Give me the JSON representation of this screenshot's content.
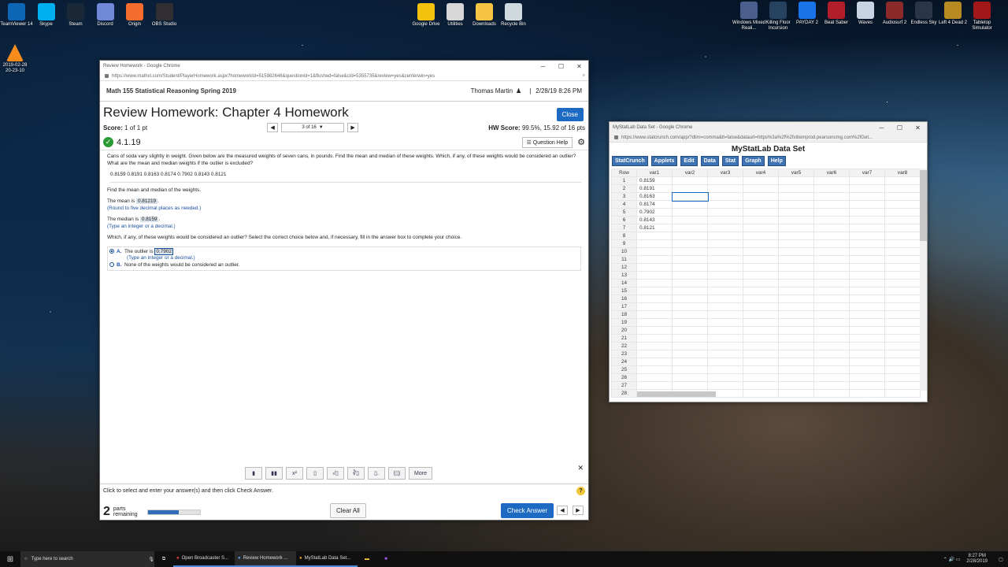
{
  "desktop": {
    "left_icons": [
      {
        "label": "TeamViewer 14",
        "color": "#0e66b7"
      },
      {
        "label": "Skype",
        "color": "#00aff0"
      },
      {
        "label": "Steam",
        "color": "#1b2838"
      },
      {
        "label": "Discord",
        "color": "#7289da"
      },
      {
        "label": "Origin",
        "color": "#f56c2d"
      },
      {
        "label": "OBS Studio",
        "color": "#302e31"
      }
    ],
    "vlc_label": "2019-02-28 20-23-10",
    "center_icons": [
      {
        "label": "Google Drive",
        "color": "#f4c20d"
      },
      {
        "label": "Utilities",
        "color": "#d7d7d7"
      },
      {
        "label": "Downloads",
        "color": "#f6c544"
      },
      {
        "label": "Recycle Bin",
        "color": "#cfd8dc"
      }
    ],
    "right_icons": [
      {
        "label": "Windows Mixed Reali...",
        "color": "#4b5f8f"
      },
      {
        "label": "Killing Floor Incursion",
        "color": "#26425f"
      },
      {
        "label": "PAYDAY 2",
        "color": "#1a73e8"
      },
      {
        "label": "Beat Saber",
        "color": "#b11e2a"
      },
      {
        "label": "Waves",
        "color": "#c8d4e4"
      },
      {
        "label": "Audiosurf 2",
        "color": "#8a2a2a"
      },
      {
        "label": "Endless Sky",
        "color": "#283648"
      },
      {
        "label": "Left 4 Dead 2",
        "color": "#b88a22"
      },
      {
        "label": "Tabletop Simulator",
        "color": "#a21818"
      }
    ]
  },
  "mymath": {
    "window_title": "Review Homework - Google Chrome",
    "url": "https://www.mathxl.com/Student/PlayerHomework.aspx?homeworkId=515982646&questionId=1&flushed=false&cId=5355735&review=yes&centerwin=yes",
    "course": "Math 155 Statistical Reasoning Spring 2019",
    "user": "Thomas Martin",
    "datetime": "2/28/19 8:26 PM",
    "separator": "|",
    "title": "Review Homework: Chapter 4 Homework",
    "close": "Close",
    "score_label": "Score:",
    "score_value": "1 of 1 pt",
    "question_nav": "3 of 16",
    "hw_score_label": "HW Score:",
    "hw_score_value": "99.5%, 15.92 of 16 pts",
    "question_id": "4.1.19",
    "question_help": "Question Help",
    "prompt": "Cans of soda vary slightly in weight. Given below are the measured weights of seven cans, in pounds. Find the mean and median of these weights. Which, if any, of these weights would be considered an outlier? What are the mean and median weights if the outlier is excluded?",
    "weights": [
      "0.8159",
      "0.8191",
      "0.8163",
      "0.8174",
      "0.7902",
      "0.8143",
      "0.8121"
    ],
    "find_text": "Find the mean and median of the weights.",
    "mean_prefix": "The mean is",
    "mean_value": "0.81219",
    "mean_hint": "(Round to five decimal places as needed.)",
    "median_prefix": "The median is",
    "median_value": "0.8159",
    "median_hint": "(Type an integer or a decimal.)",
    "outlier_question": "Which, if any, of these weights would be considered an outlier? Select the correct choice below and, if necessary, fill in the answer box to complete your choice.",
    "choice_a_letter": "A.",
    "choice_a_text": "The outlier is",
    "choice_a_value": "0.7902",
    "choice_a_hint": "(Type an integer or a decimal.)",
    "choice_b_letter": "B.",
    "choice_b_text": "None of the weights would be considered an outlier.",
    "tools": [
      "▮",
      "▮▮",
      "x²",
      "▯",
      "√▯",
      "∛▯",
      "▯.",
      "(▯)"
    ],
    "more": "More",
    "instruction": "Click to select and enter your answer(s) and then click Check Answer.",
    "parts_num": "2",
    "parts_text": "parts",
    "remaining_text": "remaining",
    "progress": 0.6,
    "clear_all": "Clear All",
    "check_answer": "Check Answer"
  },
  "statcrunch": {
    "window_title": "MyStatLab Data Set - Google Chrome",
    "url": "https://www.statcrunch.com/app/?dlim=comma&lt=false&dataurl=https%3a%2f%2fxlitemprod.pearsoncmg.com%2fGet...",
    "title": "MyStatLab Data Set",
    "menu": [
      "StatCrunch",
      "Applets",
      "Edit",
      "Data",
      "Stat",
      "Graph",
      "Help"
    ],
    "columns": [
      "Row",
      "var1",
      "var2",
      "var3",
      "var4",
      "var5",
      "var6",
      "var7",
      "var8"
    ],
    "var1": [
      "0.8159",
      "0.8191",
      "0.8163",
      "0.8174",
      "0.7902",
      "0.8143",
      "0.8121"
    ]
  },
  "taskbar": {
    "search": "Type here to search",
    "apps": [
      "Open Broadcaster S...",
      "Review Homework ...",
      "MyStatLab Data Set..."
    ],
    "time": "8:27 PM",
    "date": "2/28/2019"
  }
}
